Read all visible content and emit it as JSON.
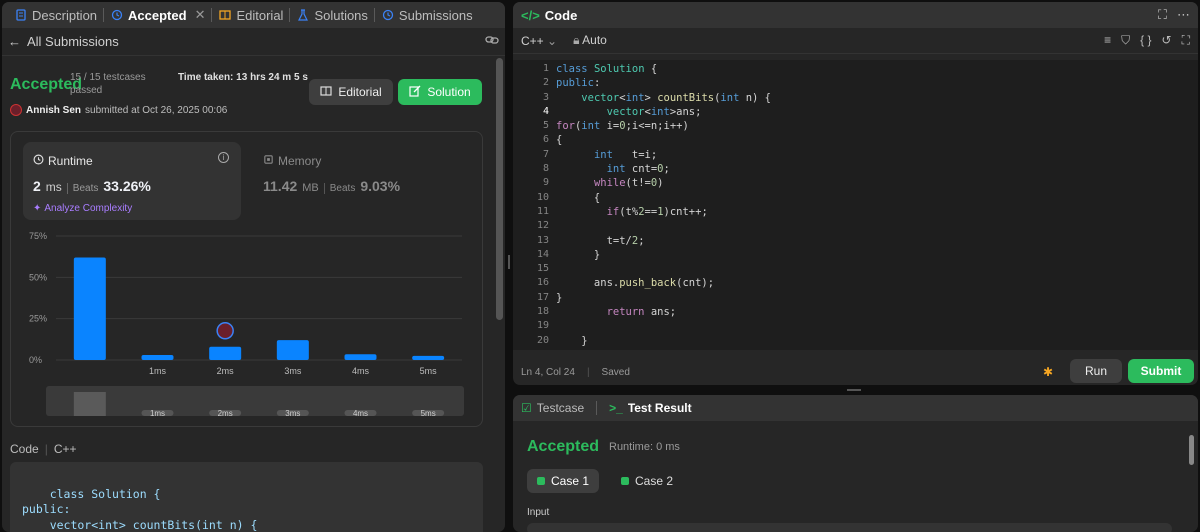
{
  "left_tabs": [
    {
      "label": "Description",
      "icon": "description-icon"
    },
    {
      "label": "Accepted",
      "icon": "history-icon",
      "active": true,
      "closable": true
    },
    {
      "label": "Editorial",
      "icon": "book-icon"
    },
    {
      "label": "Solutions",
      "icon": "flask-icon"
    },
    {
      "label": "Submissions",
      "icon": "history-icon"
    }
  ],
  "submission": {
    "back_label": "All Submissions",
    "status": "Accepted",
    "testcases": "15 / 15 testcases passed",
    "time_taken_label": "Time taken: 13 hrs 24 m 5 s",
    "user": "Annish Sen",
    "submitted_at": "submitted at Oct 26, 2025 00:06",
    "editorial_btn": "Editorial",
    "solution_btn": "Solution"
  },
  "runtime": {
    "title": "Runtime",
    "value": "2",
    "unit": "ms",
    "beats_label": "Beats",
    "beats_pct": "33.26%",
    "analyze_label": "Analyze Complexity"
  },
  "memory": {
    "title": "Memory",
    "value": "11.42",
    "unit": "MB",
    "beats_label": "Beats",
    "beats_pct": "9.03%"
  },
  "chart_data": {
    "type": "bar",
    "categories": [
      "",
      "1ms",
      "2ms",
      "3ms",
      "4ms",
      "5ms"
    ],
    "values": [
      62,
      3,
      8,
      12,
      3.5,
      2.5
    ],
    "yticks": [
      "75%",
      "50%",
      "25%",
      "0%"
    ],
    "ylim": [
      0,
      75
    ],
    "highlight_index": 2,
    "bar_color": "#0a84ff",
    "mini_labels": [
      "1ms",
      "2ms",
      "3ms",
      "4ms",
      "5ms"
    ]
  },
  "code_section": {
    "label": "Code",
    "lang": "C++",
    "snippet": "class Solution {\npublic:\n    vector<int> countBits(int n) {\n        vector<int>ans;"
  },
  "editor": {
    "title": "Code",
    "language": "C++",
    "mode": "Auto",
    "status_pos": "Ln 4, Col 24",
    "status_saved": "Saved",
    "run_label": "Run",
    "submit_label": "Submit",
    "line_numbers": [
      "1",
      "2",
      "3",
      "4",
      "5",
      "6",
      "7",
      "8",
      "9",
      "10",
      "11",
      "12",
      "13",
      "14",
      "15",
      "16",
      "17",
      "18",
      "19",
      "20"
    ]
  },
  "result": {
    "tab_testcase": "Testcase",
    "tab_result": "Test Result",
    "status": "Accepted",
    "runtime": "Runtime: 0 ms",
    "case1": "Case 1",
    "case2": "Case 2",
    "input_label": "Input"
  },
  "colors": {
    "accent_green": "#2cbb5d",
    "bar_blue": "#0a84ff",
    "analyze_purple": "#a97dff"
  }
}
